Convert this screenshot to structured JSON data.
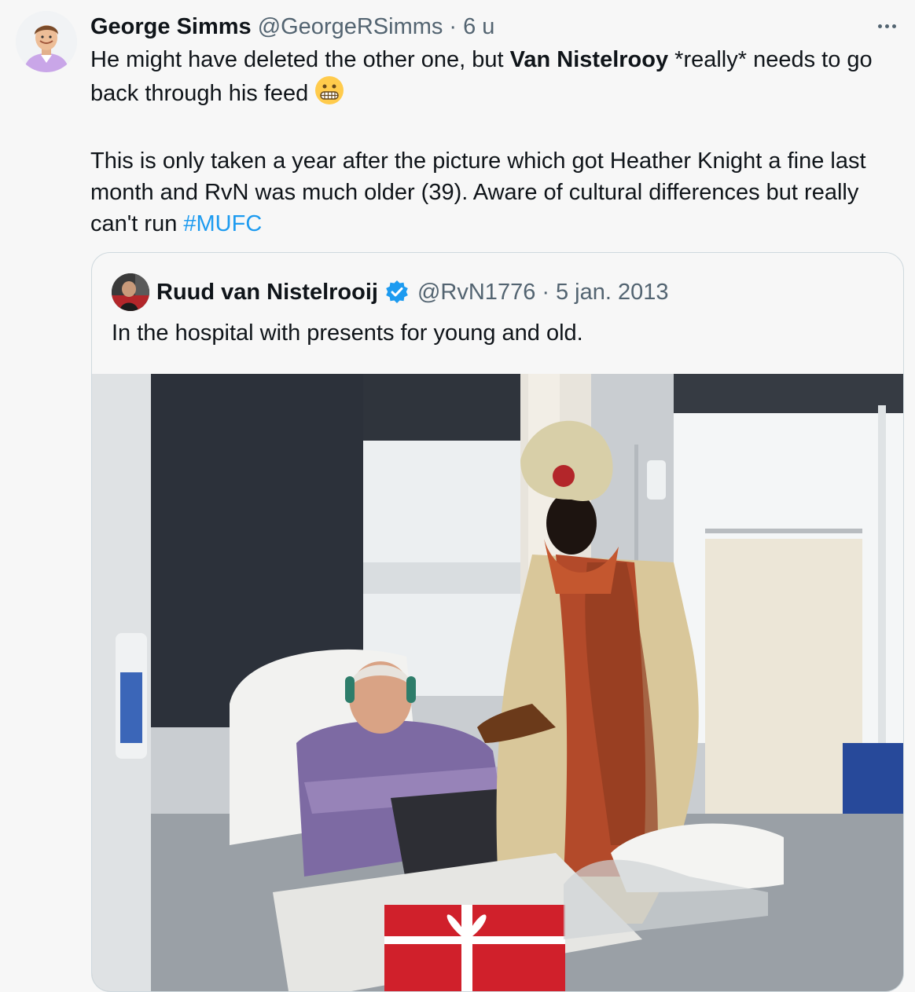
{
  "tweet": {
    "author_name": "George Simms",
    "author_handle": "@GeorgeRSimms",
    "separator": "·",
    "time": "6 u",
    "line1_a": "He might have deleted the other one, but ",
    "line1_bold": "Van Nistelrooy",
    "line1_b": " *really* needs to go back through his feed ",
    "emoji": "grimacing-face-emoji",
    "para2": "This is only taken a year after the picture which got Heather Knight a fine last month and RvN was much older (39). Aware of cultural differences but really can't run ",
    "hashtag": "#MUFC"
  },
  "quote": {
    "author_name": "Ruud van Nistelrooij",
    "author_handle": "@RvN1776",
    "separator": "·",
    "date": "5 jan. 2013",
    "text": "In the hospital with presents for young and old."
  },
  "icons": {
    "more": "more-icon",
    "verified": "verified-badge-icon"
  },
  "colors": {
    "text": "#0f1419",
    "secondary": "#536471",
    "link": "#1d9bf0",
    "border": "#cfd9de",
    "background": "#f7f7f7"
  }
}
